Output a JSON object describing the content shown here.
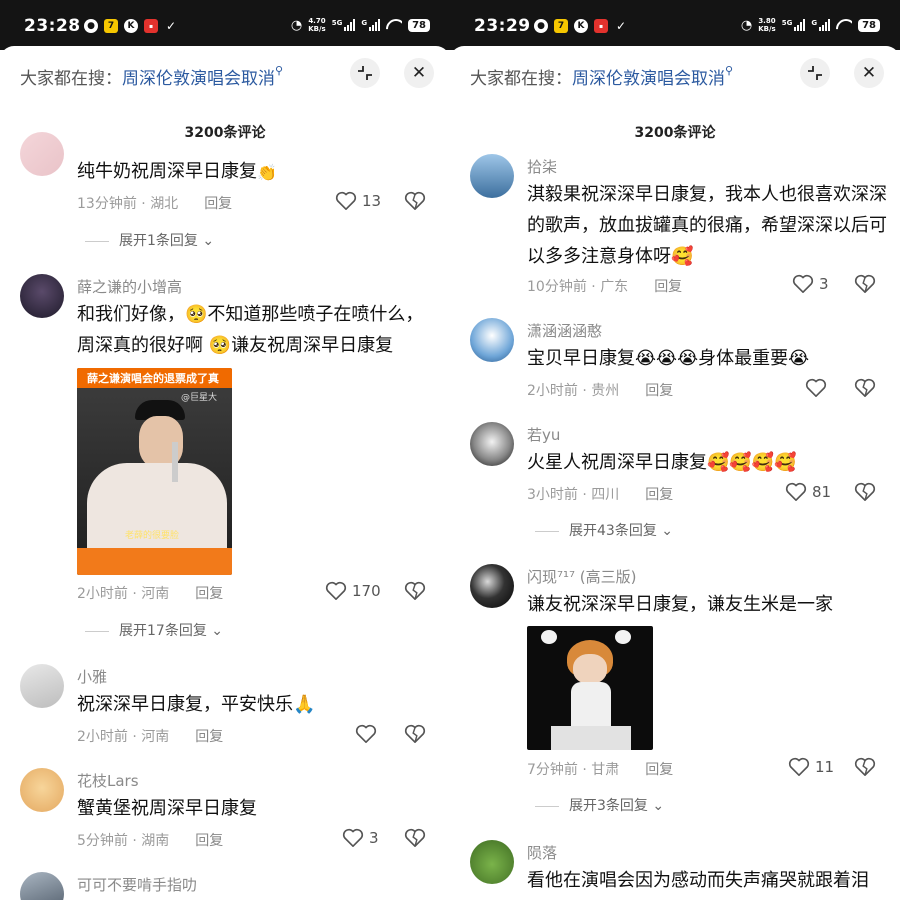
{
  "left": {
    "status": {
      "time": "23:28",
      "speed_top": "4.70",
      "speed_bottom": "KB/s",
      "battery": "78",
      "net": "5G",
      "net2": "G"
    },
    "search": {
      "hint": "大家都在搜：",
      "keyword": "周深伦敦演唱会取消"
    },
    "comment_count": "3200条评论",
    "comments": [
      {
        "username": "",
        "text": "纯牛奶祝周深早日康复",
        "emoji": "👏",
        "time": "13分钟前",
        "location": "湖北",
        "reply": "回复",
        "likes": "13",
        "expand": "展开1条回复"
      },
      {
        "username": "薛之谦的小增高",
        "text": "和我们好像，🥺不知道那些喷子在喷什么，周深真的很好啊 🥺谦友祝周深早日康复",
        "photo_caption": "薛之谦演唱会的退票成了真",
        "photo_watermark": "@巨星大",
        "photo_subtitle": "老薛的很要脸",
        "time": "2小时前",
        "location": "河南",
        "reply": "回复",
        "likes": "170",
        "expand": "展开17条回复"
      },
      {
        "username": "小雅",
        "text": "祝深深早日康复，平安快乐🙏",
        "time": "2小时前",
        "location": "河南",
        "reply": "回复",
        "likes": ""
      },
      {
        "username": "花枝Lars",
        "text": "蟹黄堡祝周深早日康复",
        "time": "5分钟前",
        "location": "湖南",
        "reply": "回复",
        "likes": "3"
      },
      {
        "username": "可可不要啃手指叻"
      }
    ]
  },
  "right": {
    "status": {
      "time": "23:29",
      "speed_top": "3.80",
      "speed_bottom": "KB/s",
      "battery": "78",
      "net": "5G",
      "net2": "G"
    },
    "search": {
      "hint": "大家都在搜：",
      "keyword": "周深伦敦演唱会取消"
    },
    "comment_count": "3200条评论",
    "comments": [
      {
        "username": "拾柒",
        "text": "淇毅果祝深深早日康复，我本人也很喜欢深深的歌声，放血拔罐真的很痛，希望深深以后可以多多注意身体呀🥰",
        "time": "10分钟前",
        "location": "广东",
        "reply": "回复",
        "likes": "3"
      },
      {
        "username": "潇涵涵涵憨",
        "text": "宝贝早日康复😭😭😭身体最重要😭",
        "time": "2小时前",
        "location": "贵州",
        "reply": "回复",
        "likes": ""
      },
      {
        "username": "若yu",
        "text": "火星人祝周深早日康复🥰🥰🥰🥰",
        "time": "3小时前",
        "location": "四川",
        "reply": "回复",
        "likes": "81",
        "expand": "展开43条回复"
      },
      {
        "username": "闪现⁷¹⁷ (高三版)",
        "text": "谦友祝深深早日康复，谦友生米是一家",
        "time": "7分钟前",
        "location": "甘肃",
        "reply": "回复",
        "likes": "11",
        "expand": "展开3条回复"
      },
      {
        "username": "陨落",
        "text": "看他在演唱会因为感动而失声痛哭就跟着泪"
      }
    ]
  },
  "icons": {
    "heart": "heart-icon",
    "dislike": "broken-heart-icon",
    "collapse": "collapse-icon",
    "close": "close-icon"
  },
  "colors": {
    "accent_link": "#2c5aa0",
    "meta_gray": "#9b9b9b"
  }
}
